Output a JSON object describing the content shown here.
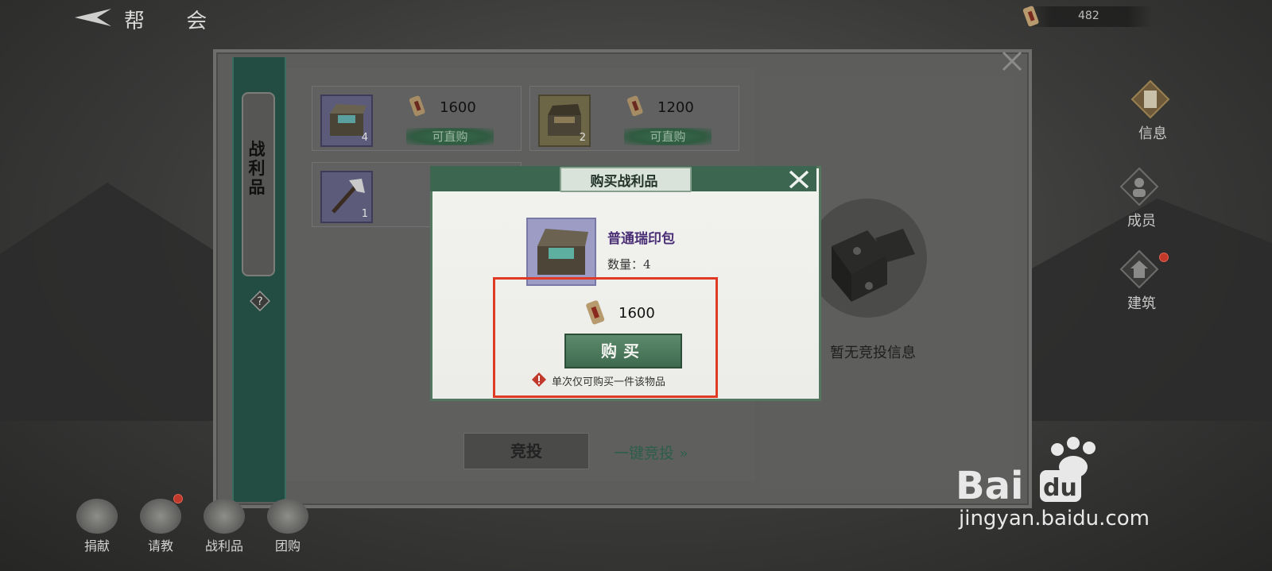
{
  "header": {
    "title": "帮 会",
    "currency_value": "482"
  },
  "side_tab": {
    "label": "战利品"
  },
  "items": [
    {
      "count": "4",
      "price": "1600",
      "action": "可直购",
      "thumb": "box-blue"
    },
    {
      "count": "2",
      "price": "1200",
      "action": "可直购",
      "thumb": "box-gold"
    },
    {
      "count": "1",
      "thumb": "axe"
    }
  ],
  "actions": {
    "bid_label": "竞投",
    "oneclick_label": "一键竞投 »"
  },
  "right_panel": {
    "empty_text": "暂无竞投信息"
  },
  "right_nav": [
    {
      "label": "信息",
      "icon": "scroll-icon"
    },
    {
      "label": "成员",
      "icon": "member-icon"
    },
    {
      "label": "建筑",
      "icon": "building-icon"
    }
  ],
  "bottom_nav": [
    {
      "label": "捐献",
      "icon": "donate-icon"
    },
    {
      "label": "请教",
      "icon": "consult-icon"
    },
    {
      "label": "战利品",
      "icon": "loot-icon"
    },
    {
      "label": "团购",
      "icon": "groupbuy-icon"
    }
  ],
  "dialog": {
    "title": "购买战利品",
    "item_name": "普通瑞印包",
    "quantity_text": "数量：4",
    "price": "1600",
    "buy_label": "购买",
    "warning": "单次仅可购买一件该物品"
  },
  "watermark": {
    "text": "jingyan.baidu.com"
  },
  "colors": {
    "accent_green": "#3d6651",
    "highlight_red": "#e03a24",
    "item_name_purple": "#4a2f76"
  }
}
